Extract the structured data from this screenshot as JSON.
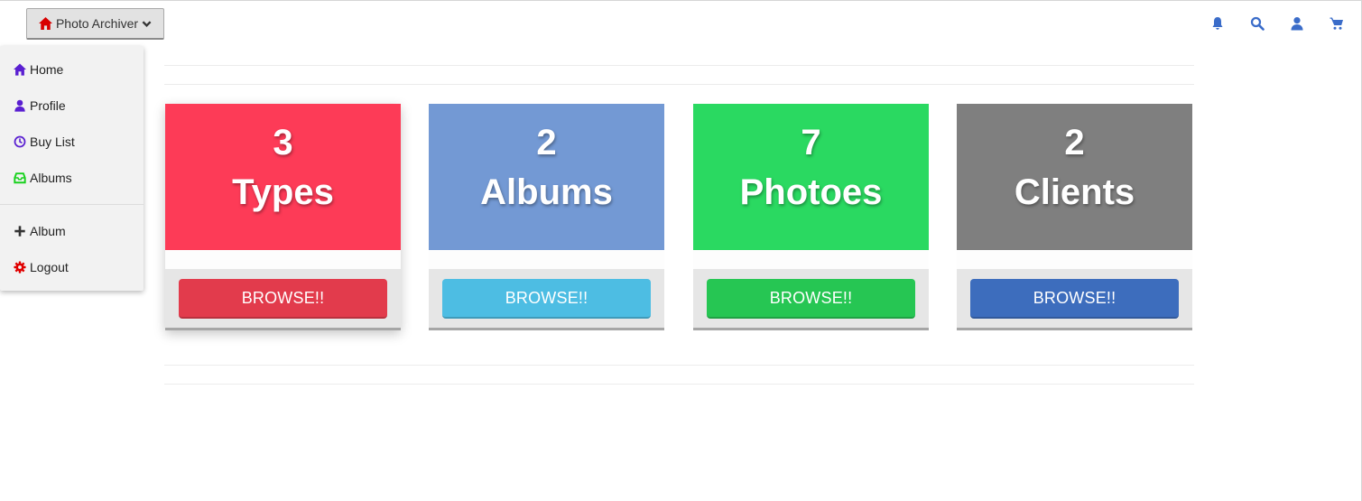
{
  "header": {
    "brand_label": "Photo Archiver",
    "brand_icon": "home-icon",
    "brand_icon_color": "#d80000",
    "icons": [
      "bell-icon",
      "search-icon",
      "user-icon",
      "cart-icon"
    ],
    "icon_color": "#3a6cc9"
  },
  "menu": {
    "items": [
      {
        "label": "Home",
        "icon": "home-icon",
        "color": "#5a1fd1"
      },
      {
        "label": "Profile",
        "icon": "user-icon",
        "color": "#5a1fd1"
      },
      {
        "label": "Buy List",
        "icon": "clock-icon",
        "color": "#5a1fd1"
      },
      {
        "label": "Albums",
        "icon": "inbox-icon",
        "color": "#19d11e"
      }
    ],
    "secondary": [
      {
        "label": "Album",
        "icon": "plus-icon",
        "color": "#333333"
      },
      {
        "label": "Logout",
        "icon": "gear-icon",
        "color": "#e00000"
      }
    ]
  },
  "cards": [
    {
      "count": "3",
      "label": "Types",
      "button": "BROWSE!!",
      "color": "#fd3b57",
      "button_color": "#e23b4c"
    },
    {
      "count": "2",
      "label": "Albums",
      "button": "BROWSE!!",
      "color": "#7399d4",
      "button_color": "#4dbde3"
    },
    {
      "count": "7",
      "label": "Photoes",
      "button": "BROWSE!!",
      "color": "#2ad961",
      "button_color": "#26c653"
    },
    {
      "count": "2",
      "label": "Clients",
      "button": "BROWSE!!",
      "color": "#7f7f7f",
      "button_color": "#3d6dbd"
    }
  ]
}
